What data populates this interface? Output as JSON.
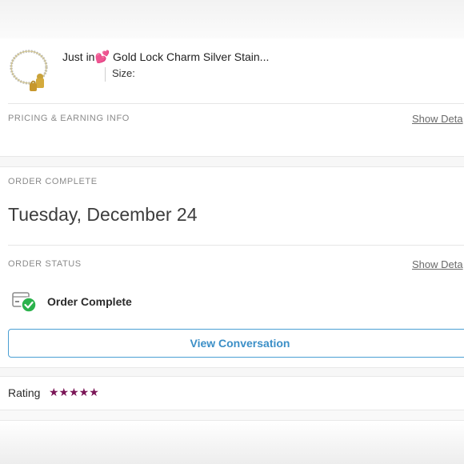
{
  "product": {
    "title_prefix": "Just in",
    "title_emoji": "💕",
    "title_rest": " Gold Lock Charm Silver Stain...",
    "size_label": "Size:"
  },
  "pricing": {
    "label": "PRICING & EARNING INFO",
    "show_details": "Show Deta"
  },
  "order_complete": {
    "label": "ORDER COMPLETE",
    "date": "Tuesday, December 24"
  },
  "order_status": {
    "label": "ORDER STATUS",
    "show_details": "Show Deta",
    "status_text": "Order Complete"
  },
  "actions": {
    "view_conversation": "View Conversation"
  },
  "rating": {
    "label": "Rating",
    "stars_text": "★★★★★",
    "value": 5,
    "max": 5
  },
  "colors": {
    "accent_blue": "#3b8fc7",
    "star_color": "#7a1456",
    "check_green": "#2bb24c",
    "heart_pink": "#e7369a"
  }
}
